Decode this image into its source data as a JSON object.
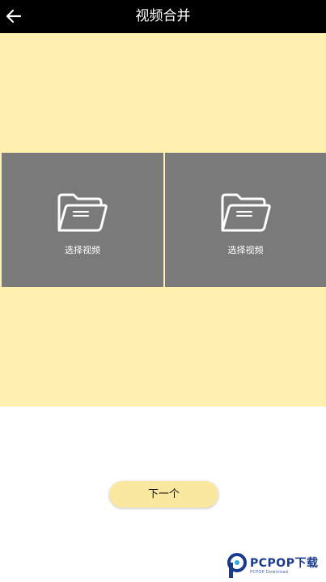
{
  "header": {
    "title": "视频合并",
    "back_icon": "arrow-left-icon"
  },
  "slots": [
    {
      "label": "选择视频",
      "icon": "folder-open-icon"
    },
    {
      "label": "选择视频",
      "icon": "folder-open-icon"
    }
  ],
  "actions": {
    "next_label": "下一个"
  },
  "watermark": {
    "brand": "PCPOP下载",
    "sub": "PCPOP Download"
  },
  "colors": {
    "header_bg": "#000000",
    "panel_bg": "#fff0b0",
    "slot_bg": "#7a7a7a",
    "button_bg": "#fbe8a0"
  }
}
